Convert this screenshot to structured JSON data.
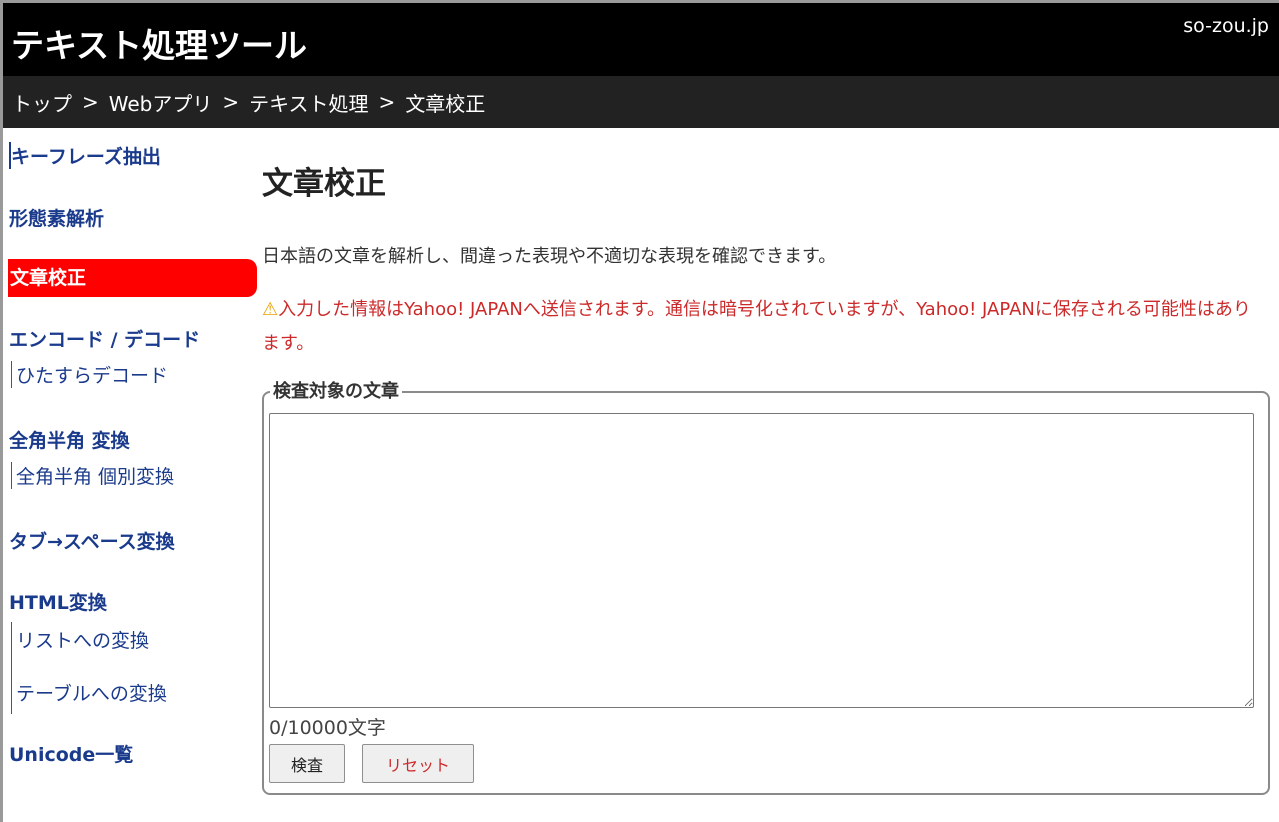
{
  "header": {
    "title": "テキスト処理ツール",
    "domain": "so-zou.jp"
  },
  "breadcrumb": [
    "トップ",
    "Webアプリ",
    "テキスト処理",
    "文章校正"
  ],
  "breadcrumb_sep": ">",
  "sidebar": {
    "items": [
      {
        "label": "キーフレーズ抽出"
      },
      {
        "label": "形態素解析"
      },
      {
        "label": "文章校正",
        "active": true
      },
      {
        "label": "エンコード / デコード"
      },
      {
        "label": "ひたすらデコード",
        "sub": true
      },
      {
        "label": "全角半角 変換"
      },
      {
        "label": "全角半角 個別変換",
        "sub": true
      },
      {
        "label": "タブ→スペース変換"
      },
      {
        "label": "HTML変換"
      },
      {
        "label": "リストへの変換",
        "sub": true
      },
      {
        "label": "テーブルへの変換",
        "sub": true
      },
      {
        "label": "Unicode一覧"
      }
    ]
  },
  "main": {
    "title": "文章校正",
    "description": "日本語の文章を解析し、間違った表現や不適切な表現を確認できます。",
    "warning_icon": "⚠",
    "warning": "入力した情報はYahoo! JAPANへ送信されます。通信は暗号化されていますが、Yahoo! JAPANに保存される可能性はあります。",
    "form": {
      "legend": "検査対象の文章",
      "textarea_value": "",
      "counter": "0/10000文字",
      "check_label": "検査",
      "reset_label": "リセット"
    }
  },
  "colors": {
    "accent": "#ff0000",
    "link": "#1a3a8c",
    "warning": "#cc2a2a",
    "header_bg": "#000000",
    "breadcrumb_bg": "#222222"
  }
}
